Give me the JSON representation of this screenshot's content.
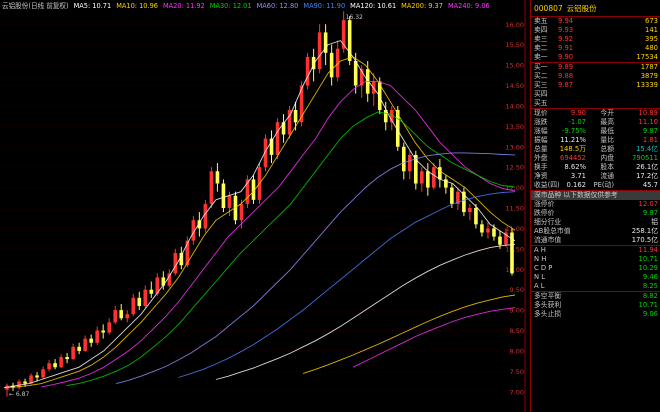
{
  "ma_legend": [
    {
      "label": "云铝股份(日线 前复权)",
      "color": "#c8c8c8"
    },
    {
      "label": "MA5: 10.71",
      "color": "#ffffff"
    },
    {
      "label": "MA10: 10.96",
      "color": "#ffd200"
    },
    {
      "label": "MA20: 11.92",
      "color": "#ff33ff"
    },
    {
      "label": "MA30: 12.01",
      "color": "#00d200"
    },
    {
      "label": "MA60: 12.80",
      "color": "#9090ff"
    },
    {
      "label": "MA90: 11.90",
      "color": "#4a80ff"
    },
    {
      "label": "MA120: 10.61",
      "color": "#ffffff"
    },
    {
      "label": "MA200: 9.37",
      "color": "#ffd200"
    },
    {
      "label": "MA240: 9.06",
      "color": "#ff33ff"
    }
  ],
  "chart_data": {
    "type": "candlestick",
    "y_ticks": [
      16.0,
      15.5,
      15.0,
      14.5,
      14.0,
      13.5,
      13.0,
      12.5,
      12.0,
      11.5,
      11.0,
      10.5,
      10.0,
      9.5,
      9.0,
      8.5,
      8.0,
      7.5,
      7.0
    ],
    "ylim": [
      6.7,
      16.3
    ],
    "high_label": "16.32",
    "low_label": "6.87",
    "candles": [
      [
        7.05,
        7.15,
        6.88,
        7.2
      ],
      [
        7.15,
        7.1,
        7.02,
        7.22
      ],
      [
        7.1,
        7.25,
        7.05,
        7.3
      ],
      [
        7.25,
        7.2,
        7.12,
        7.32
      ],
      [
        7.2,
        7.4,
        7.18,
        7.45
      ],
      [
        7.4,
        7.35,
        7.25,
        7.48
      ],
      [
        7.35,
        7.55,
        7.3,
        7.62
      ],
      [
        7.55,
        7.7,
        7.5,
        7.78
      ],
      [
        7.7,
        7.6,
        7.55,
        7.8
      ],
      [
        7.6,
        7.85,
        7.58,
        7.92
      ],
      [
        7.85,
        7.8,
        7.7,
        7.95
      ],
      [
        7.8,
        8.1,
        7.78,
        8.18
      ],
      [
        8.1,
        8.0,
        7.92,
        8.2
      ],
      [
        8.0,
        8.3,
        7.98,
        8.38
      ],
      [
        8.3,
        8.2,
        8.1,
        8.4
      ],
      [
        8.2,
        8.5,
        8.15,
        8.6
      ],
      [
        8.5,
        8.45,
        8.3,
        8.65
      ],
      [
        8.45,
        8.7,
        8.4,
        8.8
      ],
      [
        8.7,
        9.0,
        8.65,
        9.1
      ],
      [
        9.0,
        8.8,
        8.75,
        9.15
      ],
      [
        8.8,
        8.9,
        8.7,
        9.0
      ],
      [
        8.9,
        9.3,
        8.85,
        9.4
      ],
      [
        9.3,
        9.1,
        9.0,
        9.45
      ],
      [
        9.1,
        9.5,
        9.05,
        9.6
      ],
      [
        9.5,
        9.4,
        9.3,
        9.7
      ],
      [
        9.4,
        9.8,
        9.35,
        9.9
      ],
      [
        9.8,
        9.6,
        9.5,
        9.95
      ],
      [
        9.6,
        9.9,
        9.55,
        10.0
      ],
      [
        9.9,
        10.4,
        9.85,
        10.5
      ],
      [
        10.4,
        10.1,
        10.0,
        10.55
      ],
      [
        10.1,
        10.7,
        10.05,
        10.8
      ],
      [
        10.7,
        11.2,
        10.6,
        11.3
      ],
      [
        11.2,
        11.0,
        10.8,
        11.4
      ],
      [
        11.0,
        11.6,
        10.9,
        11.7
      ],
      [
        11.6,
        12.4,
        11.5,
        12.5
      ],
      [
        12.4,
        12.1,
        11.9,
        12.6
      ],
      [
        12.1,
        11.5,
        11.4,
        12.2
      ],
      [
        11.5,
        11.8,
        11.3,
        11.9
      ],
      [
        11.8,
        11.2,
        11.1,
        11.9
      ],
      [
        11.2,
        11.6,
        11.0,
        11.7
      ],
      [
        11.6,
        12.2,
        11.5,
        12.3
      ],
      [
        12.2,
        11.7,
        11.6,
        12.3
      ],
      [
        11.7,
        12.5,
        11.6,
        12.6
      ],
      [
        12.5,
        13.2,
        12.4,
        13.3
      ],
      [
        13.2,
        12.8,
        12.6,
        13.4
      ],
      [
        12.8,
        13.6,
        12.7,
        13.7
      ],
      [
        13.6,
        13.3,
        13.1,
        13.8
      ],
      [
        13.3,
        13.9,
        13.2,
        14.0
      ],
      [
        13.9,
        13.6,
        13.4,
        14.1
      ],
      [
        13.6,
        14.5,
        13.5,
        14.6
      ],
      [
        14.5,
        15.2,
        14.4,
        15.3
      ],
      [
        15.2,
        14.9,
        14.6,
        15.4
      ],
      [
        14.9,
        15.8,
        14.8,
        16.0
      ],
      [
        15.8,
        15.3,
        15.0,
        16.0
      ],
      [
        15.3,
        14.7,
        14.5,
        15.5
      ],
      [
        14.7,
        15.4,
        14.6,
        15.6
      ],
      [
        15.4,
        16.1,
        15.3,
        16.32
      ],
      [
        16.1,
        15.1,
        15.0,
        16.2
      ],
      [
        15.1,
        14.5,
        14.3,
        15.3
      ],
      [
        14.5,
        14.9,
        14.2,
        15.0
      ],
      [
        14.9,
        14.3,
        14.1,
        15.1
      ],
      [
        14.3,
        14.6,
        14.0,
        14.8
      ],
      [
        14.6,
        13.9,
        13.8,
        14.7
      ],
      [
        13.9,
        13.6,
        13.4,
        14.1
      ],
      [
        13.6,
        13.9,
        13.4,
        14.0
      ],
      [
        13.9,
        13.0,
        12.9,
        14.0
      ],
      [
        13.0,
        12.4,
        12.2,
        13.1
      ],
      [
        12.4,
        12.8,
        12.2,
        12.9
      ],
      [
        12.8,
        12.1,
        11.95,
        12.9
      ],
      [
        12.1,
        12.4,
        11.9,
        12.5
      ],
      [
        12.4,
        12.0,
        11.8,
        12.6
      ],
      [
        12.0,
        12.5,
        11.95,
        12.6
      ],
      [
        12.5,
        12.2,
        12.0,
        12.7
      ],
      [
        12.2,
        12.0,
        11.85,
        12.3
      ],
      [
        12.0,
        11.6,
        11.5,
        12.1
      ],
      [
        11.6,
        11.9,
        11.45,
        12.0
      ],
      [
        11.9,
        11.4,
        11.3,
        12.0
      ],
      [
        11.4,
        11.5,
        11.2,
        11.6
      ],
      [
        11.5,
        11.1,
        11.0,
        11.6
      ],
      [
        11.1,
        10.9,
        10.8,
        11.2
      ],
      [
        10.9,
        11.0,
        10.75,
        11.15
      ],
      [
        11.0,
        10.8,
        10.7,
        11.1
      ],
      [
        10.8,
        10.6,
        10.5,
        10.95
      ],
      [
        10.6,
        10.9,
        10.55,
        11.0
      ],
      [
        10.9,
        9.9,
        9.85,
        11.0
      ]
    ],
    "ma_lines": [
      {
        "name": "MA5",
        "color": "#ffffff",
        "values": [
          7.1,
          7.15,
          7.2,
          7.3,
          7.4,
          7.5,
          7.6,
          7.8,
          8.0,
          8.3,
          8.6,
          8.9,
          9.3,
          9.7,
          10.2,
          10.8,
          11.3,
          11.7,
          11.8,
          11.9,
          12.3,
          12.9,
          13.4,
          13.8,
          14.5,
          15.1,
          15.5,
          15.6,
          15.2,
          14.7,
          14.3,
          13.7,
          13.2,
          12.7,
          12.4,
          12.2,
          12.1,
          11.8,
          11.5,
          11.1,
          10.9,
          10.7
        ]
      },
      {
        "name": "MA10",
        "color": "#ffd200",
        "values": [
          7.1,
          7.12,
          7.15,
          7.2,
          7.3,
          7.4,
          7.5,
          7.65,
          7.85,
          8.1,
          8.4,
          8.7,
          9.05,
          9.4,
          9.8,
          10.3,
          10.8,
          11.2,
          11.4,
          11.6,
          11.9,
          12.3,
          12.8,
          13.3,
          13.8,
          14.3,
          14.8,
          15.1,
          15.2,
          15.0,
          14.6,
          14.1,
          13.6,
          13.1,
          12.7,
          12.4,
          12.2,
          12.0,
          11.7,
          11.4,
          11.15,
          10.96
        ]
      },
      {
        "name": "MA20",
        "color": "#ff33ff",
        "values": [
          null,
          null,
          null,
          7.12,
          7.18,
          7.25,
          7.33,
          7.45,
          7.6,
          7.8,
          8.0,
          8.25,
          8.55,
          8.85,
          9.2,
          9.6,
          10.0,
          10.4,
          10.8,
          11.1,
          11.4,
          11.7,
          12.0,
          12.4,
          12.8,
          13.2,
          13.7,
          14.1,
          14.4,
          14.6,
          14.6,
          14.5,
          14.2,
          13.9,
          13.5,
          13.1,
          12.8,
          12.5,
          12.3,
          12.1,
          11.98,
          11.92
        ]
      },
      {
        "name": "MA30",
        "color": "#00d200",
        "values": [
          null,
          null,
          null,
          null,
          null,
          7.15,
          7.2,
          7.28,
          7.38,
          7.5,
          7.65,
          7.85,
          8.1,
          8.35,
          8.65,
          9.0,
          9.35,
          9.7,
          10.05,
          10.4,
          10.7,
          11.0,
          11.3,
          11.6,
          12.0,
          12.4,
          12.8,
          13.2,
          13.5,
          13.7,
          13.85,
          13.8,
          13.6,
          13.3,
          13.0,
          12.8,
          12.6,
          12.45,
          12.3,
          12.15,
          12.05,
          12.01
        ]
      },
      {
        "name": "MA60",
        "color": "#9090ff",
        "values": [
          null,
          null,
          null,
          null,
          null,
          null,
          null,
          null,
          null,
          7.2,
          7.28,
          7.38,
          7.5,
          7.62,
          7.78,
          7.95,
          8.15,
          8.35,
          8.6,
          8.85,
          9.1,
          9.4,
          9.7,
          10.0,
          10.35,
          10.7,
          11.05,
          11.4,
          11.7,
          12.0,
          12.25,
          12.45,
          12.6,
          12.7,
          12.78,
          12.82,
          12.85,
          12.85,
          12.84,
          12.83,
          12.81,
          12.8
        ]
      },
      {
        "name": "MA90",
        "color": "#4a80ff",
        "values": [
          null,
          null,
          null,
          null,
          null,
          null,
          null,
          null,
          null,
          null,
          null,
          null,
          null,
          null,
          7.35,
          7.45,
          7.55,
          7.68,
          7.82,
          7.98,
          8.15,
          8.35,
          8.55,
          8.78,
          9.0,
          9.25,
          9.5,
          9.75,
          10.0,
          10.25,
          10.5,
          10.75,
          10.95,
          11.15,
          11.3,
          11.45,
          11.6,
          11.7,
          11.78,
          11.84,
          11.88,
          11.9
        ]
      },
      {
        "name": "MA120",
        "color": "#ffffff",
        "values": [
          null,
          null,
          null,
          null,
          null,
          null,
          null,
          null,
          null,
          null,
          null,
          null,
          null,
          null,
          null,
          null,
          null,
          7.3,
          7.38,
          7.48,
          7.58,
          7.7,
          7.82,
          7.95,
          8.1,
          8.25,
          8.42,
          8.6,
          8.8,
          9.0,
          9.2,
          9.4,
          9.6,
          9.78,
          9.95,
          10.1,
          10.23,
          10.35,
          10.45,
          10.53,
          10.58,
          10.61
        ]
      },
      {
        "name": "MA200",
        "color": "#ffd200",
        "values": [
          null,
          null,
          null,
          null,
          null,
          null,
          null,
          null,
          null,
          null,
          null,
          null,
          null,
          null,
          null,
          null,
          null,
          null,
          null,
          null,
          null,
          null,
          null,
          null,
          7.45,
          7.55,
          7.66,
          7.78,
          7.9,
          8.03,
          8.16,
          8.3,
          8.44,
          8.58,
          8.72,
          8.85,
          8.97,
          9.08,
          9.17,
          9.25,
          9.32,
          9.37
        ]
      },
      {
        "name": "MA240",
        "color": "#ff33ff",
        "values": [
          null,
          null,
          null,
          null,
          null,
          null,
          null,
          null,
          null,
          null,
          null,
          null,
          null,
          null,
          null,
          null,
          null,
          null,
          null,
          null,
          null,
          null,
          null,
          null,
          null,
          null,
          null,
          null,
          7.6,
          7.75,
          7.9,
          8.05,
          8.2,
          8.35,
          8.48,
          8.6,
          8.72,
          8.82,
          8.9,
          8.97,
          9.02,
          9.06
        ]
      }
    ]
  },
  "panel": {
    "code": "000807",
    "name": "云铝股份",
    "sells": [
      {
        "label": "卖五",
        "price": "9.94",
        "vol": "673"
      },
      {
        "label": "卖四",
        "price": "9.93",
        "vol": "141"
      },
      {
        "label": "卖三",
        "price": "9.92",
        "vol": "395"
      },
      {
        "label": "卖二",
        "price": "9.91",
        "vol": "480"
      },
      {
        "label": "卖一",
        "price": "9.90",
        "vol": "17534"
      }
    ],
    "buys": [
      {
        "label": "买一",
        "price": "9.89",
        "vol": "1787"
      },
      {
        "label": "买二",
        "price": "9.88",
        "vol": "3879"
      },
      {
        "label": "买三",
        "price": "9.87",
        "vol": "13339"
      },
      {
        "label": "买四",
        "price": "",
        "vol": ""
      },
      {
        "label": "买五",
        "price": "",
        "vol": ""
      }
    ],
    "quotes": [
      {
        "l1": "现价",
        "v1": "9.90",
        "c1": "red",
        "l2": "今开",
        "v2": "10.89",
        "c2": "red"
      },
      {
        "l1": "涨跌",
        "v1": "-1.07",
        "c1": "grn",
        "l2": "最高",
        "v2": "11.10",
        "c2": "red"
      },
      {
        "l1": "涨幅",
        "v1": "-9.75%",
        "c1": "grn",
        "l2": "最低",
        "v2": "9.87",
        "c2": "grn"
      },
      {
        "l1": "振幅",
        "v1": "11.21%",
        "c1": "wht",
        "l2": "量比",
        "v2": "1.81",
        "c2": "red"
      },
      {
        "l1": "总量",
        "v1": "148.5万",
        "c1": "yel",
        "l2": "总额",
        "v2": "15.4亿",
        "c2": "cyn"
      },
      {
        "l1": "外盘",
        "v1": "694452",
        "c1": "red",
        "l2": "内盘",
        "v2": "790511",
        "c2": "grn"
      },
      {
        "l1": "换手",
        "v1": "8.62%",
        "c1": "wht",
        "l2": "股本",
        "v2": "26.1亿",
        "c2": "wht"
      },
      {
        "l1": "净资",
        "v1": "3.71",
        "c1": "wht",
        "l2": "流通",
        "v2": "17.2亿",
        "c2": "wht"
      },
      {
        "l1": "收益(四)",
        "v1": "0.162",
        "c1": "wht",
        "l2": "PE(动)",
        "v2": "45.7",
        "c2": "wht"
      }
    ],
    "section_title": "深市品种 以下数据仅供参考",
    "limits": [
      {
        "l": "涨停价",
        "v": "12.07",
        "c": "red"
      },
      {
        "l": "跌停价",
        "v": "9.87",
        "c": "grn"
      },
      {
        "l": "细分行业",
        "v": "铝",
        "c": "wht"
      },
      {
        "l": "AB股总市值",
        "v": "258.1亿",
        "c": "wht"
      },
      {
        "l": "流通市值",
        "v": "170.5亿",
        "c": "wht"
      }
    ],
    "indicators": [
      {
        "l": "A H",
        "v": "11.94",
        "c": "red"
      },
      {
        "l": "N H",
        "v": "10.71",
        "c": "grn"
      },
      {
        "l": "C D P",
        "v": "10.29",
        "c": "grn"
      },
      {
        "l": "N L",
        "v": "9.46",
        "c": "grn"
      },
      {
        "l": "A L",
        "v": "8.25",
        "c": "grn"
      }
    ],
    "signals": [
      {
        "l": "多空平衡",
        "v": "8.82",
        "c": "grn"
      },
      {
        "l": "多头获利",
        "v": "10.71",
        "c": "grn"
      },
      {
        "l": "多头止损",
        "v": "9.06",
        "c": "grn"
      }
    ]
  }
}
